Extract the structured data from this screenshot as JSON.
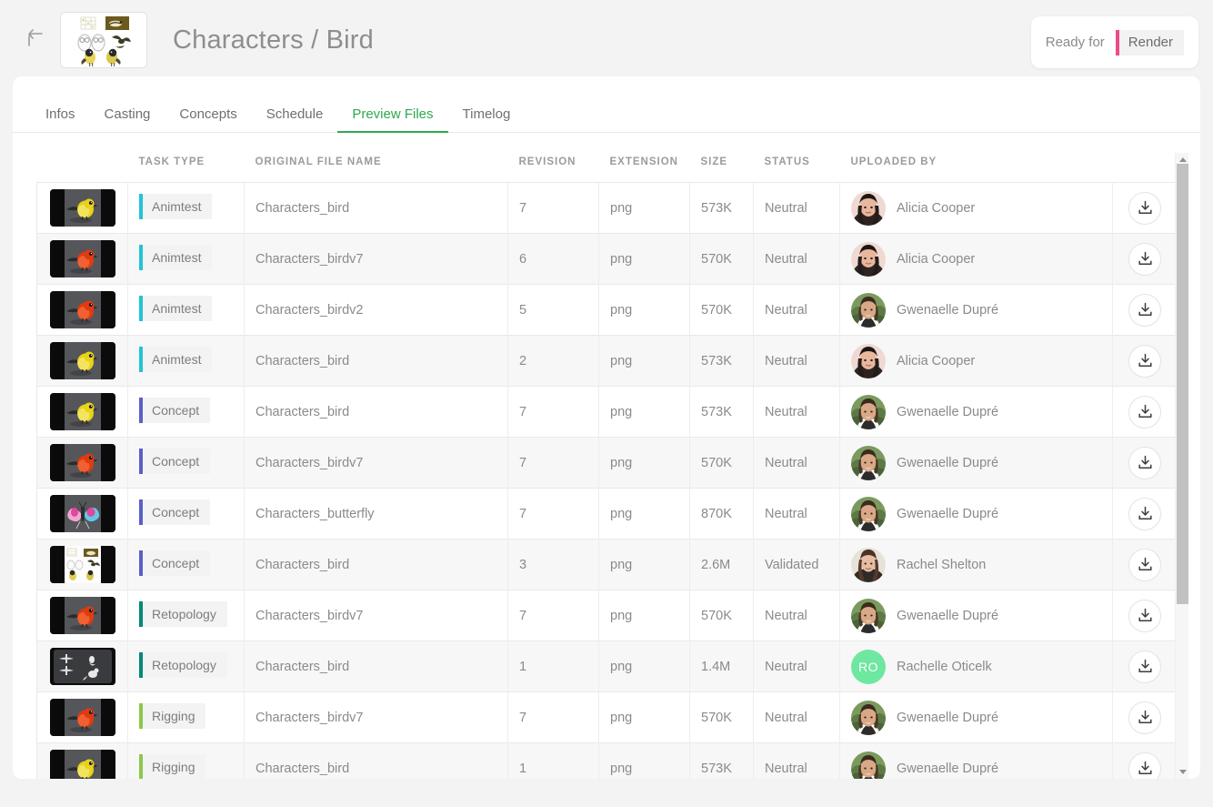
{
  "header": {
    "back_icon": "back-arrow-icon",
    "project_thumbnail_icon": "project-thumbnail",
    "title": "Characters / Bird",
    "status": {
      "ready_label": "Ready for",
      "chip_label": "Render",
      "chip_color": "#ea4c89",
      "chip_bg": "#f2f2f2"
    }
  },
  "tabs": [
    {
      "label": "Infos",
      "active": false
    },
    {
      "label": "Casting",
      "active": false
    },
    {
      "label": "Concepts",
      "active": false
    },
    {
      "label": "Schedule",
      "active": false
    },
    {
      "label": "Preview Files",
      "active": true
    },
    {
      "label": "Timelog",
      "active": false
    }
  ],
  "table": {
    "columns": [
      {
        "key": "thumbnail",
        "label": ""
      },
      {
        "key": "task_type",
        "label": "TASK TYPE"
      },
      {
        "key": "file_name",
        "label": "ORIGINAL FILE NAME"
      },
      {
        "key": "revision",
        "label": "REVISION"
      },
      {
        "key": "extension",
        "label": "EXTENSION"
      },
      {
        "key": "size",
        "label": "SIZE"
      },
      {
        "key": "status",
        "label": "STATUS"
      },
      {
        "key": "uploader",
        "label": "UPLOADED BY"
      },
      {
        "key": "download",
        "label": ""
      }
    ],
    "task_type_colors": {
      "Animtest": "#22c3d6",
      "Concept": "#5a5fc7",
      "Retopology": "#00897b",
      "Rigging": "#8cc84b"
    },
    "rows": [
      {
        "thumbnail": "bird-yellow",
        "task_type": "Animtest",
        "file_name": "Characters_bird",
        "revision": "7",
        "extension": "png",
        "size": "573K",
        "status": "Neutral",
        "uploader": "Alicia Cooper",
        "avatar_kind": "photo",
        "avatar_photo": "alicia",
        "download_icon": "download-icon"
      },
      {
        "thumbnail": "bird-red",
        "task_type": "Animtest",
        "file_name": "Characters_birdv7",
        "revision": "6",
        "extension": "png",
        "size": "570K",
        "status": "Neutral",
        "uploader": "Alicia Cooper",
        "avatar_kind": "photo",
        "avatar_photo": "alicia",
        "download_icon": "download-icon"
      },
      {
        "thumbnail": "bird-red",
        "task_type": "Animtest",
        "file_name": "Characters_birdv2",
        "revision": "5",
        "extension": "png",
        "size": "570K",
        "status": "Neutral",
        "uploader": "Gwenaelle Dupré",
        "avatar_kind": "photo",
        "avatar_photo": "gwen",
        "download_icon": "download-icon"
      },
      {
        "thumbnail": "bird-yellow",
        "task_type": "Animtest",
        "file_name": "Characters_bird",
        "revision": "2",
        "extension": "png",
        "size": "573K",
        "status": "Neutral",
        "uploader": "Alicia Cooper",
        "avatar_kind": "photo",
        "avatar_photo": "alicia",
        "download_icon": "download-icon"
      },
      {
        "thumbnail": "bird-yellow",
        "task_type": "Concept",
        "file_name": "Characters_bird",
        "revision": "7",
        "extension": "png",
        "size": "573K",
        "status": "Neutral",
        "uploader": "Gwenaelle Dupré",
        "avatar_kind": "photo",
        "avatar_photo": "gwen",
        "download_icon": "download-icon"
      },
      {
        "thumbnail": "bird-red",
        "task_type": "Concept",
        "file_name": "Characters_birdv7",
        "revision": "7",
        "extension": "png",
        "size": "570K",
        "status": "Neutral",
        "uploader": "Gwenaelle Dupré",
        "avatar_kind": "photo",
        "avatar_photo": "gwen",
        "download_icon": "download-icon"
      },
      {
        "thumbnail": "butterfly",
        "task_type": "Concept",
        "file_name": "Characters_butterfly",
        "revision": "7",
        "extension": "png",
        "size": "870K",
        "status": "Neutral",
        "uploader": "Gwenaelle Dupré",
        "avatar_kind": "photo",
        "avatar_photo": "gwen",
        "download_icon": "download-icon"
      },
      {
        "thumbnail": "sketch-sheet",
        "task_type": "Concept",
        "file_name": "Characters_bird",
        "revision": "3",
        "extension": "png",
        "size": "2.6M",
        "status": "Validated",
        "uploader": "Rachel Shelton",
        "avatar_kind": "photo",
        "avatar_photo": "rachel",
        "download_icon": "download-icon"
      },
      {
        "thumbnail": "bird-red",
        "task_type": "Retopology",
        "file_name": "Characters_birdv7",
        "revision": "7",
        "extension": "png",
        "size": "570K",
        "status": "Neutral",
        "uploader": "Gwenaelle Dupré",
        "avatar_kind": "photo",
        "avatar_photo": "gwen",
        "download_icon": "download-icon"
      },
      {
        "thumbnail": "wireframe",
        "task_type": "Retopology",
        "file_name": "Characters_bird",
        "revision": "1",
        "extension": "png",
        "size": "1.4M",
        "status": "Neutral",
        "uploader": "Rachelle Oticelk",
        "avatar_kind": "initials",
        "avatar_initials": "RO",
        "avatar_color": "#6ee7a0",
        "download_icon": "download-icon"
      },
      {
        "thumbnail": "bird-red",
        "task_type": "Rigging",
        "file_name": "Characters_birdv7",
        "revision": "7",
        "extension": "png",
        "size": "570K",
        "status": "Neutral",
        "uploader": "Gwenaelle Dupré",
        "avatar_kind": "photo",
        "avatar_photo": "gwen",
        "download_icon": "download-icon"
      },
      {
        "thumbnail": "bird-yellow",
        "task_type": "Rigging",
        "file_name": "Characters_bird",
        "revision": "1",
        "extension": "png",
        "size": "573K",
        "status": "Neutral",
        "uploader": "Gwenaelle Dupré",
        "avatar_kind": "photo",
        "avatar_photo": "gwen",
        "download_icon": "download-icon"
      }
    ]
  },
  "scrollbar": {
    "up_arrow_icon": "scroll-up-arrow-icon",
    "down_arrow_icon": "scroll-down-arrow-icon",
    "thumb": "scrollbar-thumb"
  }
}
